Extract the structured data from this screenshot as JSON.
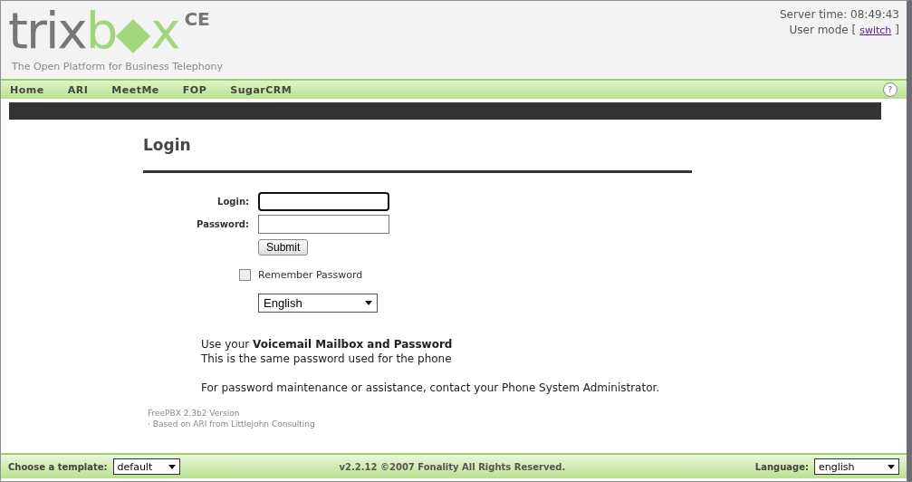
{
  "logo": {
    "dark_part": "trix",
    "green_part": "b",
    "green_end": "x",
    "badge": "CE",
    "tagline": "The Open Platform for Business Telephony"
  },
  "server_time": "Server time: 08:49:43",
  "user_mode": {
    "label": "User mode [",
    "link": "switch",
    "close": "]"
  },
  "nav": [
    {
      "label": "Home"
    },
    {
      "label": "ARI"
    },
    {
      "label": "MeetMe"
    },
    {
      "label": "FOP"
    },
    {
      "label": "SugarCRM"
    }
  ],
  "help": "?",
  "login": {
    "title": "Login",
    "fields": [
      {
        "label": "Login:",
        "focused": true
      },
      {
        "label": "Password:",
        "focused": false
      }
    ],
    "submit": "Submit",
    "remember": {
      "label": "Remember Password",
      "checked": false
    },
    "language": "English",
    "info": [
      "Use your **Voicemail Mailbox and Password**",
      "This is the same password used for the phone",
      "For password maintenance or assistance, contact your Phone System Administrator."
    ],
    "credits": [
      "FreePBX 2.3b2 Version",
      "· Based on ARI from Littlejohn Consulting"
    ]
  },
  "footer": {
    "template_label": "Choose a template:",
    "template": "default",
    "copyright": "v2.2.12 ©2007 Fonality All Rights Reserved.",
    "language_label": "Language:",
    "language": "english"
  }
}
